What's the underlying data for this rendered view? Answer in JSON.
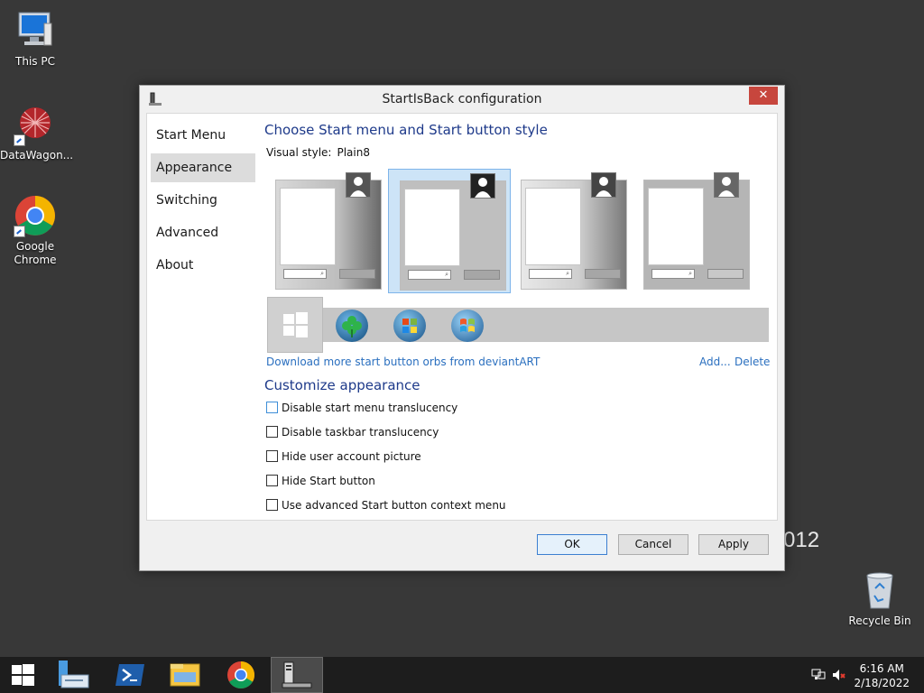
{
  "desktop": {
    "icons": [
      {
        "label": "This PC"
      },
      {
        "label": "DataWagon..."
      },
      {
        "label": "Google Chrome"
      },
      {
        "label": "Recycle Bin"
      }
    ],
    "background_text": "012"
  },
  "window": {
    "title": "StartIsBack configuration",
    "close_glyph": "✕",
    "nav": [
      {
        "label": "Start Menu"
      },
      {
        "label": "Appearance"
      },
      {
        "label": "Switching"
      },
      {
        "label": "Advanced"
      },
      {
        "label": "About"
      }
    ],
    "active_nav": "Appearance",
    "main": {
      "heading": "Choose Start menu and Start button style",
      "visual_style_label": "Visual style:",
      "visual_style_value": "Plain8",
      "download_link": "Download more start button orbs from deviantART",
      "add_link": "Add...",
      "delete_link": "Delete",
      "customize_heading": "Customize appearance",
      "checkboxes": [
        {
          "label": "Disable start menu translucency",
          "checked": false
        },
        {
          "label": "Disable taskbar translucency",
          "checked": false
        },
        {
          "label": "Hide user account picture",
          "checked": false
        },
        {
          "label": "Hide Start button",
          "checked": false
        },
        {
          "label": "Use advanced Start button context menu",
          "checked": false
        }
      ]
    },
    "buttons": {
      "ok": "OK",
      "cancel": "Cancel",
      "apply": "Apply"
    }
  },
  "taskbar": {
    "clock_time": "6:16 AM",
    "clock_date": "2/18/2022"
  },
  "colors": {
    "accent": "#1e3a8a",
    "link": "#2a6fbf",
    "close": "#c7463d",
    "desktop": "#383838",
    "taskbar": "#1d1d1d"
  }
}
